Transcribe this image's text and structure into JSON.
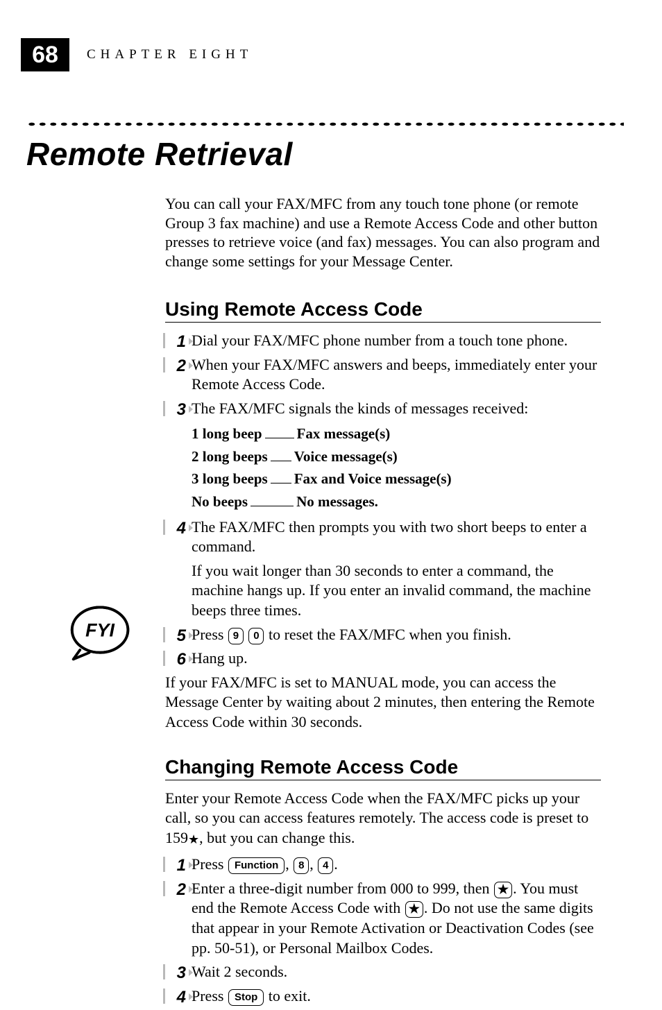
{
  "page_number": "68",
  "chapter_label": "CHAPTER EIGHT",
  "title": "Remote Retrieval",
  "intro": "You can call your FAX/MFC from any touch tone phone (or remote Group 3 fax machine) and use a Remote Access Code and other button presses to retrieve voice (and fax) messages.  You can also program and change some settings for your Message Center.",
  "section1": {
    "heading": "Using Remote Access Code",
    "step1": "Dial your FAX/MFC phone number from a touch tone phone.",
    "step2": "When your FAX/MFC answers and beeps, immediately enter your Remote Access Code.",
    "step3": "The FAX/MFC signals the kinds of messages received:",
    "signals": [
      {
        "k": "1 long beep",
        "v": "Fax message(s)",
        "dash_w": 42
      },
      {
        "k": "2 long beeps",
        "v": "Voice message(s)",
        "dash_w": 30
      },
      {
        "k": "3 long beeps",
        "v": "Fax and Voice message(s)",
        "dash_w": 30
      },
      {
        "k": "No beeps",
        "v": "No messages.",
        "dash_w": 62
      }
    ],
    "step4a": "The FAX/MFC then prompts you with two short beeps to enter a command.",
    "step4b": "If you wait longer than 30 seconds to enter a command, the machine hangs up.  If you enter an invalid command, the machine beeps three times.",
    "step5_pre": "Press ",
    "step5_k1": "9",
    "step5_k2": "0",
    "step5_post": " to reset the FAX/MFC when you finish.",
    "step6": "Hang up.",
    "note": "If your FAX/MFC is set to MANUAL mode, you can access the Message Center by waiting about 2 minutes, then entering the Remote Access Code within 30 seconds."
  },
  "section2": {
    "heading": "Changing Remote Access Code",
    "intro_pre": "Enter your Remote Access Code when the FAX/MFC picks up your call, so you can access features remotely.  The access code is preset to 159",
    "intro_post": ", but you can change this.",
    "step1_pre": "Press ",
    "step1_k1": "Function",
    "step1_k2": "8",
    "step1_k3": "4",
    "step2_a": "Enter a three-digit number from 000 to 999, then ",
    "step2_b": ".  You must end the Remote Access Code with ",
    "step2_c": ".  Do not use the same digits that appear in your Remote Activation or Deactivation Codes (see pp. 50-51), or Personal Mailbox Codes.",
    "step3": "Wait 2 seconds.",
    "step4_pre": "Press ",
    "step4_k": "Stop",
    "step4_post": " to exit."
  },
  "icons": {
    "fyi": "fyi-note-icon",
    "star": "★"
  }
}
